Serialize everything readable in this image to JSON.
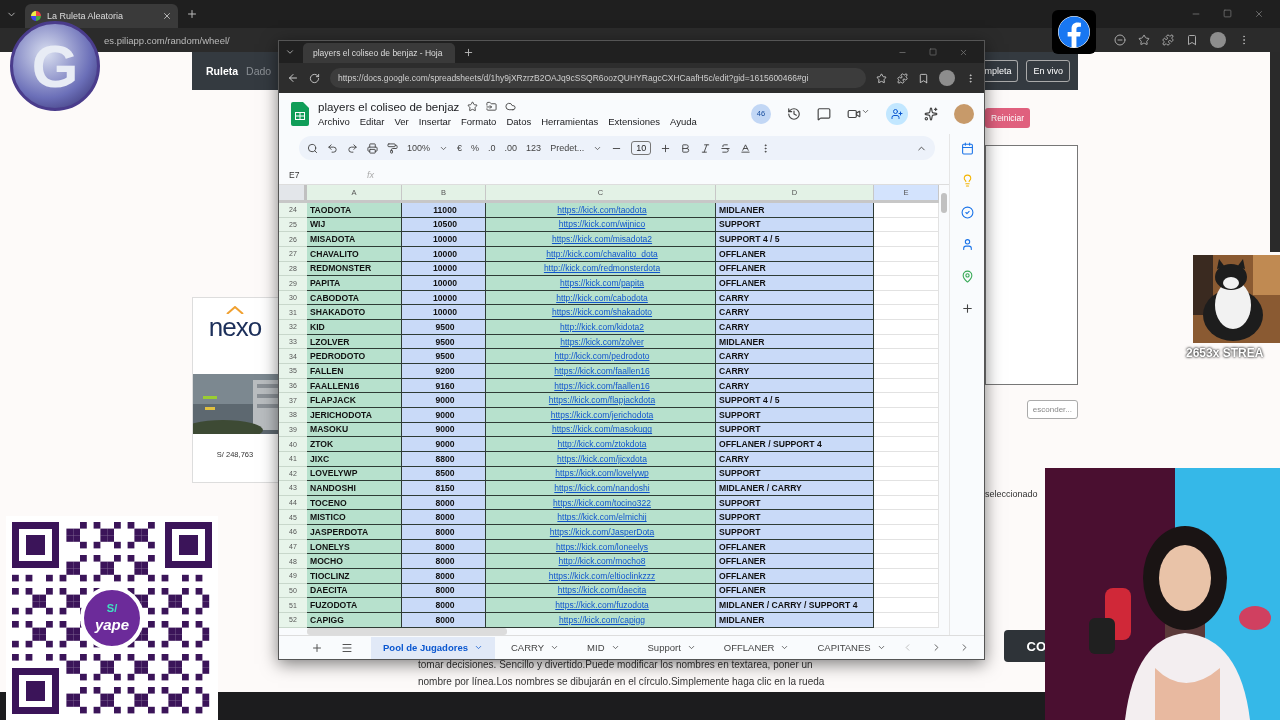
{
  "browser": {
    "tab": "La Ruleta Aleatoria",
    "url": "es.piliapp.com/random/wheel/"
  },
  "page": {
    "nav": [
      {
        "label": "Ruleta",
        "selected": true
      },
      {
        "label": "Dado",
        "selected": false
      }
    ],
    "nav_buttons": [
      "mpleta",
      "En vivo"
    ],
    "ad": {
      "logo": "nexo",
      "price": "S/ 248,763"
    },
    "reset_button": "Reiniciar",
    "hide_button": "esconder...",
    "selected_label": "seleccionado",
    "description": [
      "tomar decisiones. Sencillo y divertido.Puede modificar los nombres en textarea, poner un",
      "nombre por línea.Los nombres se dibujarán en el círculo.Simplemente haga clic en la rueda"
    ]
  },
  "sheets_window": {
    "tab_title": "players el coliseo de benjaz - Hoja",
    "url": "https://docs.google.com/spreadsheets/d/1hy9jXRzrzB2OAJq9cSSQR6oozQUHYRagcCXHCaafH5c/edit?gid=1615600466#gi",
    "doc_title": "players el coliseo de benjaz",
    "menu": [
      "Archivo",
      "Editar",
      "Ver",
      "Insertar",
      "Formato",
      "Datos",
      "Herramientas",
      "Extensiones",
      "Ayuda"
    ],
    "collaborators": "46",
    "toolbar": {
      "zoom": "100%",
      "currency": "€",
      "percent": "%",
      "decrease_decimals": ".0",
      "increase_decimals": ".00",
      "number_format": "123",
      "font": "Predet...",
      "font_size": "10"
    },
    "name_box": "E7",
    "formula_label": "fx",
    "columns": [
      {
        "label": "A",
        "selected": false,
        "color": "#b7e1cd"
      },
      {
        "label": "B",
        "selected": false,
        "color": "#c9daf8"
      },
      {
        "label": "C",
        "selected": false,
        "color": "#b7e1cd"
      },
      {
        "label": "D",
        "selected": false,
        "color": "#c9daf8"
      },
      {
        "label": "E",
        "selected": true,
        "color": "#ffffff"
      }
    ],
    "rows": [
      {
        "n": "24",
        "a": "TAODOTA",
        "b": "11000",
        "c": "https://kick.com/taodota",
        "d": "MIDLANER"
      },
      {
        "n": "25",
        "a": "WIJ",
        "b": "10500",
        "c": "https://kick.com/wijnico",
        "d": "SUPPORT"
      },
      {
        "n": "26",
        "a": "MISADOTA",
        "b": "10000",
        "c": "https://kick.com/misadota2",
        "d": "SUPPORT 4 / 5"
      },
      {
        "n": "27",
        "a": "CHAVALITO",
        "b": "10000",
        "c": "http://kick.com/chavalito_dota",
        "d": "OFFLANER"
      },
      {
        "n": "28",
        "a": "REDMONSTER",
        "b": "10000",
        "c": "http://kick.com/redmonsterdota",
        "d": "OFFLANER"
      },
      {
        "n": "29",
        "a": "PAPITA",
        "b": "10000",
        "c": "https://kick.com/papita",
        "d": "OFFLANER"
      },
      {
        "n": "30",
        "a": "CABODOTA",
        "b": "10000",
        "c": "http://kick.com/cabodota",
        "d": "CARRY"
      },
      {
        "n": "31",
        "a": "SHAKADOTO",
        "b": "10000",
        "c": "https://kick.com/shakadoto",
        "d": "CARRY"
      },
      {
        "n": "32",
        "a": "KID",
        "b": "9500",
        "c": "http://kick.com/kidota2",
        "d": "CARRY"
      },
      {
        "n": "33",
        "a": "LZOLVER",
        "b": "9500",
        "c": "https://kick.com/zolver",
        "d": "MIDLANER"
      },
      {
        "n": "34",
        "a": "PEDRODOTO",
        "b": "9500",
        "c": "http://kick.com/pedrodoto",
        "d": "CARRY"
      },
      {
        "n": "35",
        "a": "FALLEN",
        "b": "9200",
        "c": "https://kick.com/faallen16",
        "d": "CARRY"
      },
      {
        "n": "36",
        "a": "FAALLEN16",
        "b": "9160",
        "c": "https://kick.com/faallen16",
        "d": "CARRY"
      },
      {
        "n": "37",
        "a": "FLAPJACK",
        "b": "9000",
        "c": "https://kick.com/flapjackdota",
        "d": "SUPPORT 4 / 5"
      },
      {
        "n": "38",
        "a": "JERICHODOTA",
        "b": "9000",
        "c": "https://kick.com/jerichodota",
        "d": "SUPPORT"
      },
      {
        "n": "39",
        "a": "MASOKU",
        "b": "9000",
        "c": "https://kick.com/masokugg",
        "d": "SUPPORT"
      },
      {
        "n": "40",
        "a": "ZTOK",
        "b": "9000",
        "c": "http://kick.com/ztokdota",
        "d": "OFFLANER / SUPPORT 4"
      },
      {
        "n": "41",
        "a": "JIXC",
        "b": "8800",
        "c": "https://kick.com/jicxdota",
        "d": "CARRY"
      },
      {
        "n": "42",
        "a": "LOVELYWP",
        "b": "8500",
        "c": "https://kick.com/lovelywp",
        "d": "SUPPORT"
      },
      {
        "n": "43",
        "a": "NANDOSHI",
        "b": "8150",
        "c": "https://kick.com/nandoshi",
        "d": "MIDLANER / CARRY"
      },
      {
        "n": "44",
        "a": "TOCENO",
        "b": "8000",
        "c": "https://kick.com/tocino322",
        "d": "SUPPORT"
      },
      {
        "n": "45",
        "a": "MISTICO",
        "b": "8000",
        "c": "https://kick.com/elmichij",
        "d": "SUPPORT"
      },
      {
        "n": "46",
        "a": "JASPERDOTA",
        "b": "8000",
        "c": "https://kick.com/JasperDota",
        "d": "SUPPORT"
      },
      {
        "n": "47",
        "a": "LONELYS",
        "b": "8000",
        "c": "https://kick.com/loneelys",
        "d": "OFFLANER"
      },
      {
        "n": "48",
        "a": "MOCHO",
        "b": "8000",
        "c": "http://kick.com/mocho8",
        "d": "OFFLANER"
      },
      {
        "n": "49",
        "a": "TIOCLINZ",
        "b": "8000",
        "c": "https://kick.com/eltioclinkzzz",
        "d": "OFFLANER"
      },
      {
        "n": "50",
        "a": "DAECITA",
        "b": "8000",
        "c": "https://kick.com/daecita",
        "d": "OFFLANER"
      },
      {
        "n": "51",
        "a": "FUZODOTA",
        "b": "8000",
        "c": "https://kick.com/fuzodota",
        "d": "MIDLANER / CARRY / SUPPORT 4"
      },
      {
        "n": "52",
        "a": "CAPIGG",
        "b": "8000",
        "c": "https://kick.com/capigg",
        "d": "MIDLANER"
      }
    ],
    "sheet_tabs": [
      {
        "label": "Pool de Jugadores",
        "selected": true
      },
      {
        "label": "CARRY",
        "selected": false
      },
      {
        "label": "MID",
        "selected": false
      },
      {
        "label": "Support",
        "selected": false
      },
      {
        "label": "OFFLANER",
        "selected": false
      },
      {
        "label": "CAPITANES",
        "selected": false
      }
    ]
  },
  "overlays": {
    "channel_logo": "G",
    "qr_logo": [
      "S/",
      "yape"
    ],
    "cat_caption": "2653x STREA",
    "badge": "CO"
  }
}
